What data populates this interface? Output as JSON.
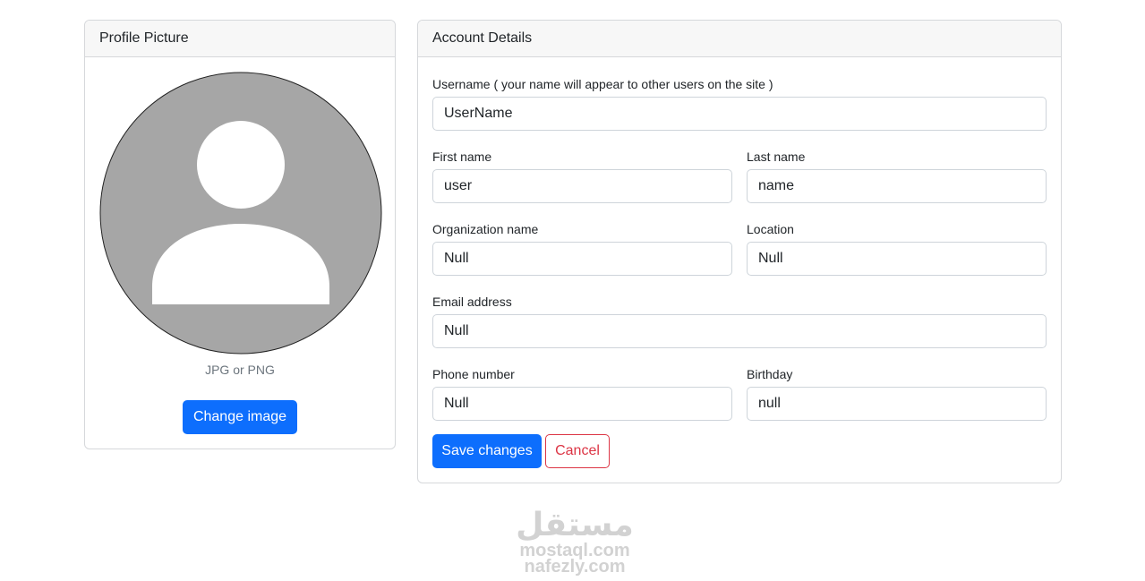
{
  "profile": {
    "header": "Profile Picture",
    "hint": "JPG or PNG",
    "change_button": "Change image"
  },
  "account": {
    "header": "Account Details",
    "username": {
      "label": "Username ( your name will appear to other users on the site )",
      "value": "UserName"
    },
    "first_name": {
      "label": "First name",
      "value": "user"
    },
    "last_name": {
      "label": "Last name",
      "value": "name"
    },
    "organization": {
      "label": "Organization name",
      "value": "Null"
    },
    "location": {
      "label": "Location",
      "value": "Null"
    },
    "email": {
      "label": "Email address",
      "value": "Null"
    },
    "phone": {
      "label": "Phone number",
      "value": "Null"
    },
    "birthday": {
      "label": "Birthday",
      "value": "null"
    },
    "save_button": "Save changes",
    "cancel_button": "Cancel"
  },
  "watermark": {
    "logo": "مستقل",
    "line1": "mostaql.com",
    "line2": "nafezly.com"
  },
  "colors": {
    "primary": "#0d6efd",
    "danger": "#dc3545",
    "avatar_bg": "#a6a6a6",
    "header_bg": "#f7f7f7",
    "border": "#d6d8db"
  },
  "icons": {
    "avatar": "user-silhouette-icon"
  }
}
